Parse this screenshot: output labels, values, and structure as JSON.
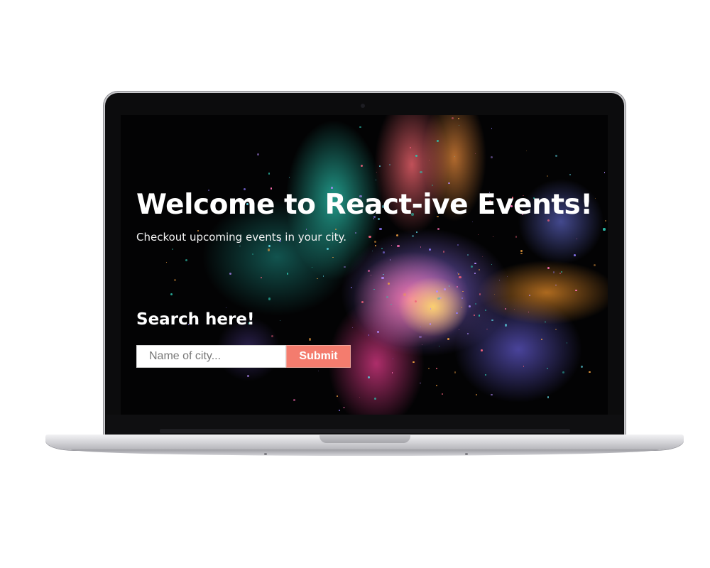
{
  "hero": {
    "title": "Welcome to React-ive Events!",
    "subtitle": "Checkout upcoming events in your city."
  },
  "search": {
    "heading": "Search here!",
    "placeholder": "Name of city...",
    "value": "",
    "submit_label": "Submit"
  },
  "colors": {
    "background": "#000000",
    "text": "#ffffff",
    "submit_button": "#f47c6e",
    "input_background": "#ffffff"
  }
}
